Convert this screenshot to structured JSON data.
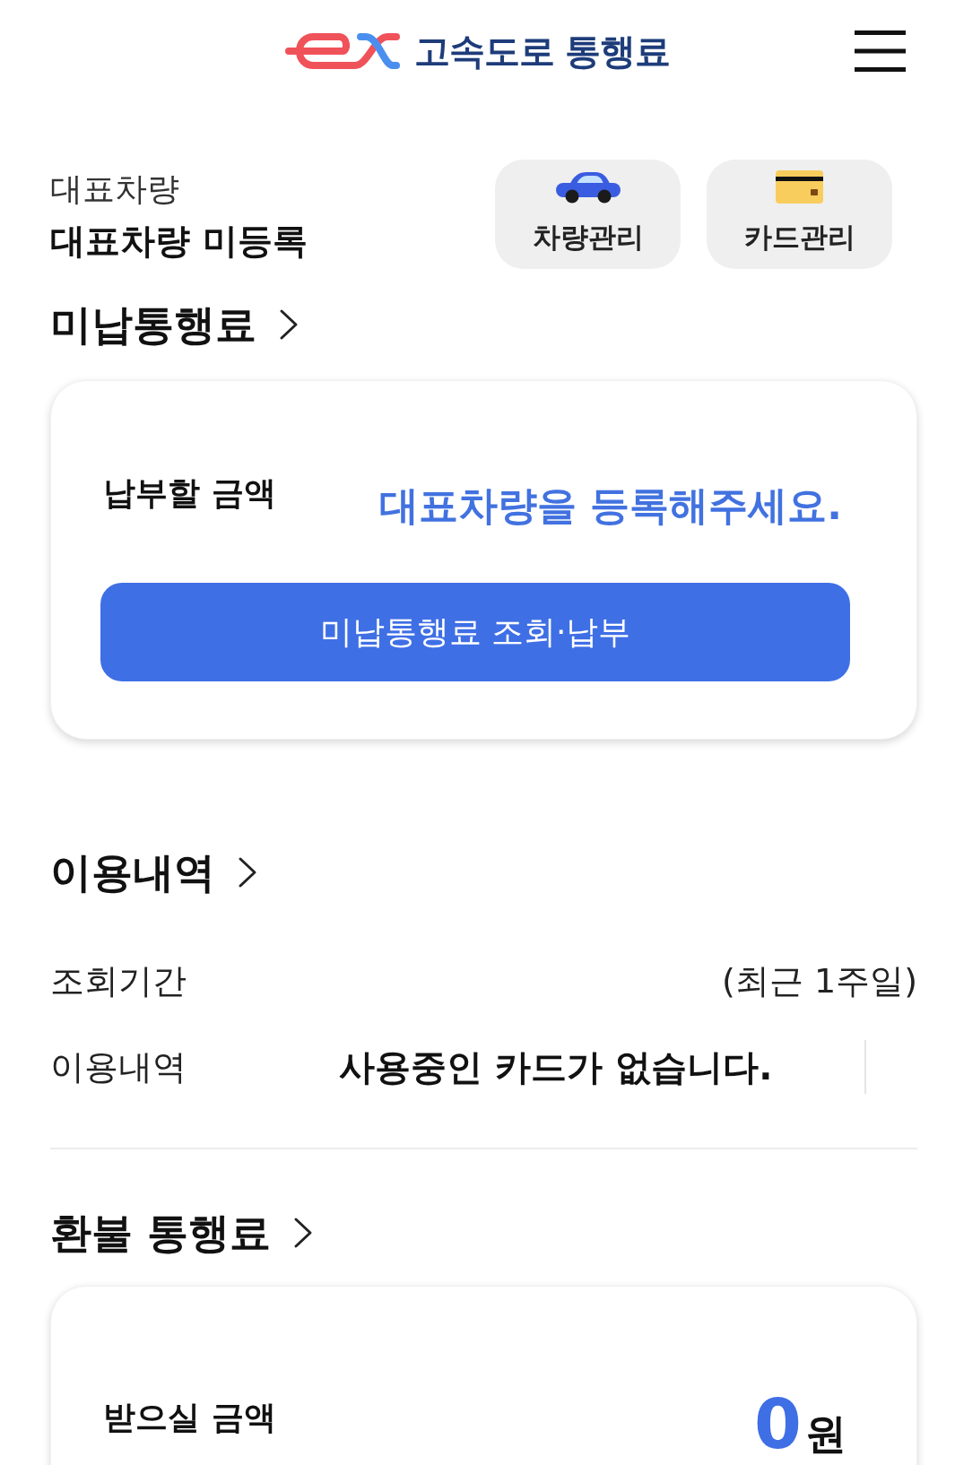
{
  "header": {
    "title": "고속도로 통행료"
  },
  "vehicle": {
    "label": "대표차량",
    "value": "대표차량 미등록"
  },
  "quick_buttons": [
    {
      "kind": "car",
      "label": "차량관리"
    },
    {
      "kind": "card",
      "label": "카드관리"
    }
  ],
  "unpaid": {
    "heading": "미납통행료",
    "amount_label": "납부할 금액",
    "message": "대표차량을 등록해주세요.",
    "button": "미납통행료 조회·납부"
  },
  "usage": {
    "heading": "이용내역",
    "rows": [
      {
        "kind": "period",
        "label": "조회기간",
        "value": "(최근 1주일)"
      },
      {
        "kind": "notice",
        "label": "이용내역",
        "value": "사용중인 카드가 없습니다."
      }
    ]
  },
  "refund": {
    "heading": "환불 통행료",
    "amount_label": "받으실 금액",
    "amount": "0",
    "unit": "원"
  }
}
